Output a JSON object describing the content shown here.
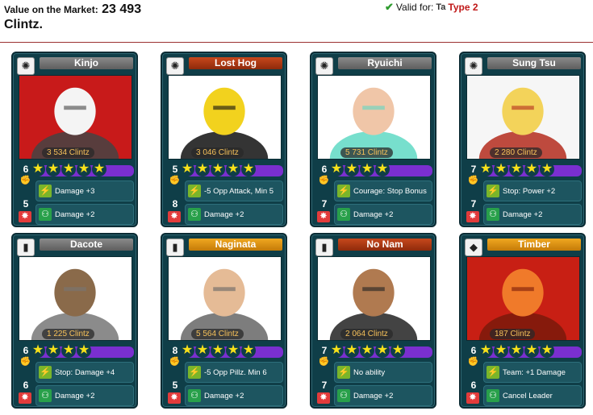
{
  "market": {
    "label": "Value on the Market:",
    "value": "23 493",
    "unit": "Clintz."
  },
  "validity": {
    "label": "Valid for:",
    "type_icon": "Ta",
    "type": "Type 2"
  },
  "cards": [
    {
      "name": "Kinjo",
      "clan_icon": "✺",
      "price": "3 534 Clintz",
      "power": "6",
      "damage": "5",
      "stars": 5,
      "ability": "Damage +3",
      "bonus": "Damage +2"
    },
    {
      "name": "Lost Hog",
      "clan_icon": "✺",
      "price": "3 046 Clintz",
      "power": "5",
      "damage": "8",
      "stars": 5,
      "ability": "-5 Opp Attack, Min 5",
      "bonus": "Damage +2"
    },
    {
      "name": "Ryuichi",
      "clan_icon": "✺",
      "price": "5 731 Clintz",
      "power": "6",
      "damage": "7",
      "stars": 4,
      "ability": "Courage: Stop Bonus",
      "bonus": "Damage +2"
    },
    {
      "name": "Sung Tsu",
      "clan_icon": "✺",
      "price": "2 280 Clintz",
      "power": "7",
      "damage": "7",
      "stars": 5,
      "ability": "Stop: Power +2",
      "bonus": "Damage +2"
    },
    {
      "name": "Dacote",
      "clan_icon": "▮",
      "price": "1 225 Clintz",
      "power": "6",
      "damage": "6",
      "stars": 4,
      "ability": "Stop: Damage +4",
      "bonus": "Damage +2"
    },
    {
      "name": "Naginata",
      "clan_icon": "▮",
      "price": "5 564 Clintz",
      "power": "8",
      "damage": "5",
      "stars": 5,
      "ability": "-5 Opp Pillz. Min 6",
      "bonus": "Damage +2"
    },
    {
      "name": "No Nam",
      "clan_icon": "▮",
      "price": "2 064 Clintz",
      "power": "7",
      "damage": "7",
      "stars": 5,
      "ability": "No ability",
      "bonus": "Damage +2"
    },
    {
      "name": "Timber",
      "clan_icon": "◆",
      "price": "187 Clintz",
      "power": "6",
      "damage": "6",
      "stars": 5,
      "ability": "Team: +1 Damage",
      "bonus": "Cancel Leader"
    }
  ],
  "icons": {
    "power": "fist-icon",
    "damage": "heart-burst-icon",
    "ability": "lightning-icon",
    "bonus": "team-icon",
    "star": "star-icon",
    "check": "checkmark-icon"
  },
  "colors": {
    "card_bg": "#0f3e48",
    "star": "#f7e11a",
    "stars_bar": "#7a2fd0",
    "price_text": "#f6c15a",
    "type_text": "#c01818"
  }
}
